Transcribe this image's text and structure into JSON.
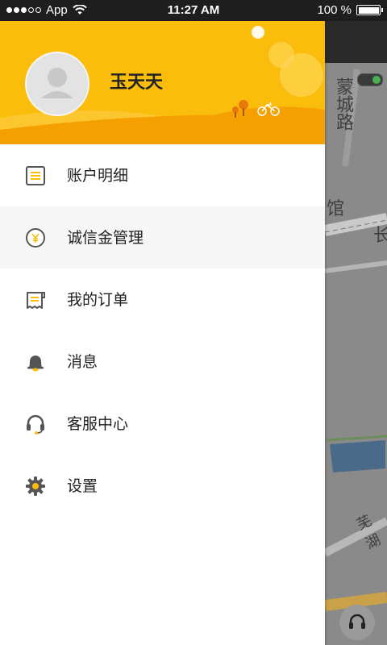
{
  "status_bar": {
    "carrier": "App",
    "time": "11:27 AM",
    "battery_text": "100 %"
  },
  "drawer": {
    "username": "玉天天",
    "menu_items": [
      {
        "label": "账户明细",
        "icon": "account-details-icon"
      },
      {
        "label": "诚信金管理",
        "icon": "yuan-coin-icon"
      },
      {
        "label": "我的订单",
        "icon": "receipt-icon"
      },
      {
        "label": "消息",
        "icon": "bell-icon"
      },
      {
        "label": "客服中心",
        "icon": "headset-icon"
      },
      {
        "label": "设置",
        "icon": "gear-icon"
      }
    ]
  },
  "map": {
    "labels": [
      "蒙城路",
      "馆",
      "长",
      "芜湖"
    ]
  },
  "colors": {
    "brand_yellow": "#fbbd0b",
    "active_row": "#f6f6f6",
    "icon_dark": "#555555"
  }
}
